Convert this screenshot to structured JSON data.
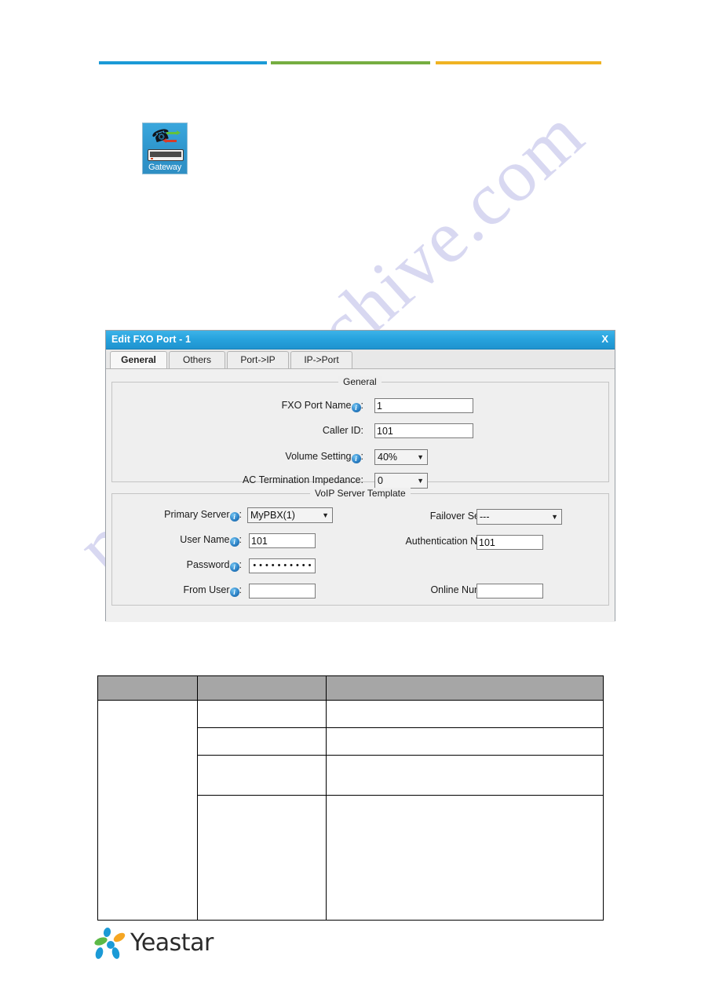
{
  "header": {
    "rules": [
      {
        "name": "blue-rule",
        "color": "#1b9ad6"
      },
      {
        "name": "green-rule",
        "color": "#76ae41"
      },
      {
        "name": "yellow-rule",
        "color": "#f0b323"
      }
    ]
  },
  "gateway_icon": {
    "label": "Gateway"
  },
  "watermark": {
    "text": "manualsarchive.com"
  },
  "dialog": {
    "title": "Edit FXO Port - 1",
    "close_label": "X",
    "tabs": [
      {
        "label": "General",
        "active": true
      },
      {
        "label": "Others",
        "active": false
      },
      {
        "label": "Port->IP",
        "active": false
      },
      {
        "label": "IP->Port",
        "active": false
      }
    ],
    "general_section": {
      "legend": "General",
      "fxo_port_name": {
        "label": "FXO Port Name",
        "separator": ":",
        "value": "1",
        "has_info": true
      },
      "caller_id": {
        "label": "Caller ID:",
        "value": "101",
        "has_info": false
      },
      "volume_setting": {
        "label": "Volume Setting",
        "separator": ":",
        "value": "40%",
        "has_info": true
      },
      "ac_termination_impedance": {
        "label": "AC Termination Impedance:",
        "value": "0",
        "has_info": false
      }
    },
    "voip_section": {
      "legend": "VoIP Server Template",
      "primary_server": {
        "label": "Primary Server",
        "separator": ":",
        "value": "MyPBX(1)",
        "has_info": true
      },
      "failover_server": {
        "label": "Failover Server",
        "separator": ":",
        "value": "---",
        "has_info": true
      },
      "user_name": {
        "label": "User Name",
        "separator": ":",
        "value": "101",
        "has_info": true
      },
      "authentication_name": {
        "label": "Authentication Name",
        "separator": ":",
        "value": "101",
        "has_info": true
      },
      "password": {
        "label": "Password",
        "separator": ":",
        "value": "••••••••••",
        "has_info": true
      },
      "from_user": {
        "label": "From User",
        "separator": ":",
        "value": "",
        "has_info": true
      },
      "online_number": {
        "label": "Online Number",
        "separator": ":",
        "value": "",
        "has_info": true
      }
    }
  },
  "spec_table": {
    "headers": [
      "",
      "",
      ""
    ],
    "rows": [
      [
        "",
        "",
        ""
      ],
      [
        "",
        "",
        ""
      ],
      [
        "",
        "",
        ""
      ],
      [
        "",
        "",
        ""
      ]
    ]
  },
  "footer": {
    "logo_text": "Yeastar"
  }
}
